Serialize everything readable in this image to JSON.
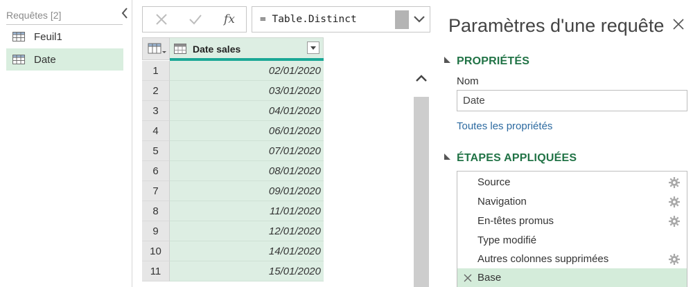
{
  "queries": {
    "header": "Requêtes [2]",
    "items": [
      {
        "label": "Feuil1",
        "icon": "table-icon",
        "selected": false
      },
      {
        "label": "Date",
        "icon": "table-icon",
        "selected": true
      }
    ]
  },
  "formula_bar": {
    "cancel_icon": "x-icon",
    "commit_icon": "checkmark-icon",
    "fx_label": "fx",
    "formula": "= Table.Distinct"
  },
  "grid": {
    "column_header": "Date sales",
    "column_type_icon": "calendar-icon",
    "rows": [
      {
        "num": "1",
        "value": "02/01/2020"
      },
      {
        "num": "2",
        "value": "03/01/2020"
      },
      {
        "num": "3",
        "value": "04/01/2020"
      },
      {
        "num": "4",
        "value": "06/01/2020"
      },
      {
        "num": "5",
        "value": "07/01/2020"
      },
      {
        "num": "6",
        "value": "08/01/2020"
      },
      {
        "num": "7",
        "value": "09/01/2020"
      },
      {
        "num": "8",
        "value": "11/01/2020"
      },
      {
        "num": "9",
        "value": "12/01/2020"
      },
      {
        "num": "10",
        "value": "14/01/2020"
      },
      {
        "num": "11",
        "value": "15/01/2020"
      }
    ]
  },
  "settings": {
    "title": "Paramètres d'une requête",
    "properties_title": "PROPRIÉTÉS",
    "name_label": "Nom",
    "name_value": "Date",
    "all_properties": "Toutes les propriétés",
    "steps_title": "ÉTAPES APPLIQUÉES",
    "steps": [
      {
        "label": "Source",
        "has_gear": true,
        "selected": false
      },
      {
        "label": "Navigation",
        "has_gear": true,
        "selected": false
      },
      {
        "label": "En-têtes promus",
        "has_gear": true,
        "selected": false
      },
      {
        "label": "Type modifié",
        "has_gear": false,
        "selected": false
      },
      {
        "label": "Autres colonnes supprimées",
        "has_gear": true,
        "selected": false
      },
      {
        "label": "Base",
        "has_gear": false,
        "selected": true
      }
    ]
  },
  "colors": {
    "accent_green": "#217346",
    "selected_bg": "#d9eedf",
    "column_bg": "#ddeee3",
    "column_accent": "#1ba896",
    "link_blue": "#2c6aa0"
  }
}
